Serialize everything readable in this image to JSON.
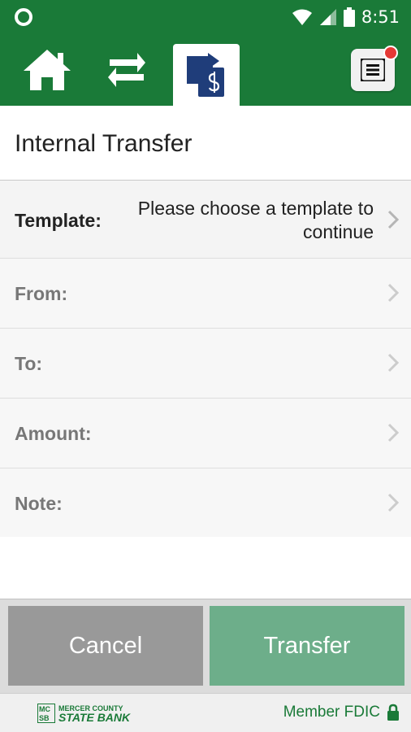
{
  "status_bar": {
    "time": "8:51"
  },
  "nav": {
    "tabs": [
      {
        "name": "home",
        "icon": "home-icon"
      },
      {
        "name": "transfer",
        "icon": "swap-arrows-icon"
      },
      {
        "name": "internal-transfer",
        "icon": "transfer-dollar-icon",
        "active": true
      }
    ],
    "menu_icon": "menu-icon",
    "has_notification": true
  },
  "page": {
    "title": "Internal Transfer"
  },
  "form": {
    "template": {
      "label": "Template:",
      "value": "Please choose a template to continue"
    },
    "from": {
      "label": "From:"
    },
    "to": {
      "label": "To:"
    },
    "amount": {
      "label": "Amount:"
    },
    "note": {
      "label": "Note:"
    }
  },
  "actions": {
    "cancel": "Cancel",
    "transfer": "Transfer"
  },
  "footer": {
    "logo": {
      "initials": "MCSB",
      "top_line": "MERCER COUNTY",
      "bottom_line": "STATE BANK"
    },
    "member_text": "Member FDIC"
  },
  "colors": {
    "brand_green": "#1a7a38",
    "navy": "#1f3d7a",
    "cancel_gray": "#999999",
    "transfer_green": "#6dae8a"
  }
}
